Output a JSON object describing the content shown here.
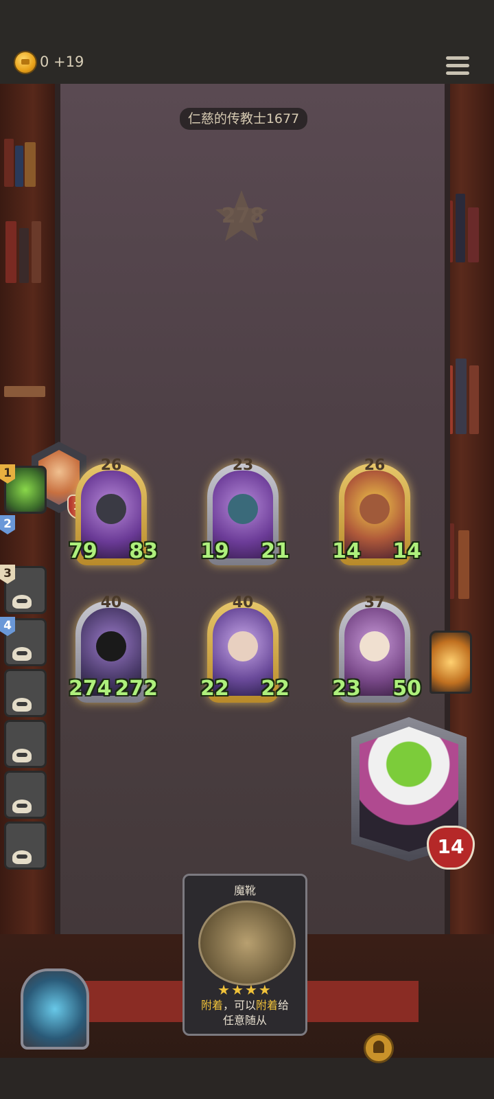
{
  "top_bar": {
    "gold_text": "0 +19",
    "menu_icon": "hamburger-menu-icon",
    "coin_icon": "gold-crown-coin-icon"
  },
  "opponent": {
    "name": "仁慈的传教士1677",
    "rank": "278",
    "hero_health": "13"
  },
  "board_minions": [
    {
      "tier": "26",
      "attack": "79",
      "health": "83"
    },
    {
      "tier": "23",
      "attack": "19",
      "health": "21"
    },
    {
      "tier": "26",
      "attack": "14",
      "health": "14"
    },
    {
      "tier": "40",
      "attack": "274",
      "health": "272"
    },
    {
      "tier": "40",
      "attack": "22",
      "health": "22"
    },
    {
      "tier": "37",
      "attack": "23",
      "health": "50"
    }
  ],
  "player": {
    "hero_health": "14"
  },
  "leaderboard": [
    {
      "place": "1",
      "eliminated": false
    },
    {
      "place": "2",
      "eliminated": false
    },
    {
      "place": "3",
      "eliminated": true
    },
    {
      "place": "4",
      "eliminated": true
    },
    {
      "place": "",
      "eliminated": true
    },
    {
      "place": "",
      "eliminated": true
    },
    {
      "place": "",
      "eliminated": true
    },
    {
      "place": "",
      "eliminated": true
    }
  ],
  "hand_card": {
    "title": "魔靴",
    "stars": "★★★★",
    "text_keyword_1": "附着",
    "text_mid": "，可以",
    "text_keyword_2": "附着",
    "text_end": "给",
    "text_line2": "任意随从"
  },
  "colors": {
    "gold_frame": "#e6c66a",
    "stat_green": "#aef07c",
    "health_red": "#b52828",
    "board_wood": "#4e4046"
  }
}
